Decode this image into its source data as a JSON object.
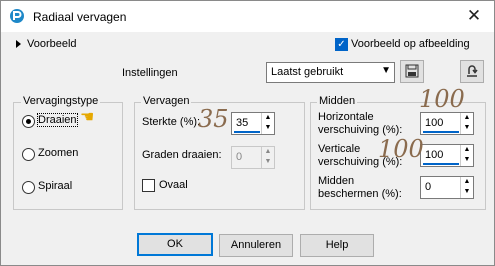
{
  "window": {
    "title": "Radiaal vervagen",
    "close_icon": "close-icon"
  },
  "preview": {
    "label": "Voorbeeld",
    "on_image_label": "Voorbeeld op afbeelding",
    "on_image_checked": true
  },
  "settings": {
    "label": "Instellingen",
    "preset_value": "Laatst gebruikt"
  },
  "blur_type": {
    "title": "Vervagingstype",
    "options": [
      {
        "label": "Draaien",
        "selected": true
      },
      {
        "label": "Zoomen",
        "selected": false
      },
      {
        "label": "Spiraal",
        "selected": false
      }
    ]
  },
  "blur": {
    "title": "Vervagen",
    "strength_label": "Sterkte (%):",
    "strength_value": "35",
    "twist_label": "Graden draaien:",
    "twist_value": "0",
    "oval_label": "Ovaal",
    "oval_checked": false
  },
  "center": {
    "title": "Midden",
    "h_offset_label_1": "Horizontale",
    "h_offset_label_2": "verschuiving (%):",
    "h_offset_value": "100",
    "v_offset_label_1": "Verticale",
    "v_offset_label_2": "verschuiving (%):",
    "v_offset_value": "100",
    "protect_label_1": "Midden",
    "protect_label_2": "beschermen (%):",
    "protect_value": "0"
  },
  "annotations": {
    "strength": "35",
    "h_offset": "100",
    "v_offset": "100"
  },
  "buttons": {
    "ok": "OK",
    "cancel": "Annuleren",
    "help": "Help"
  }
}
